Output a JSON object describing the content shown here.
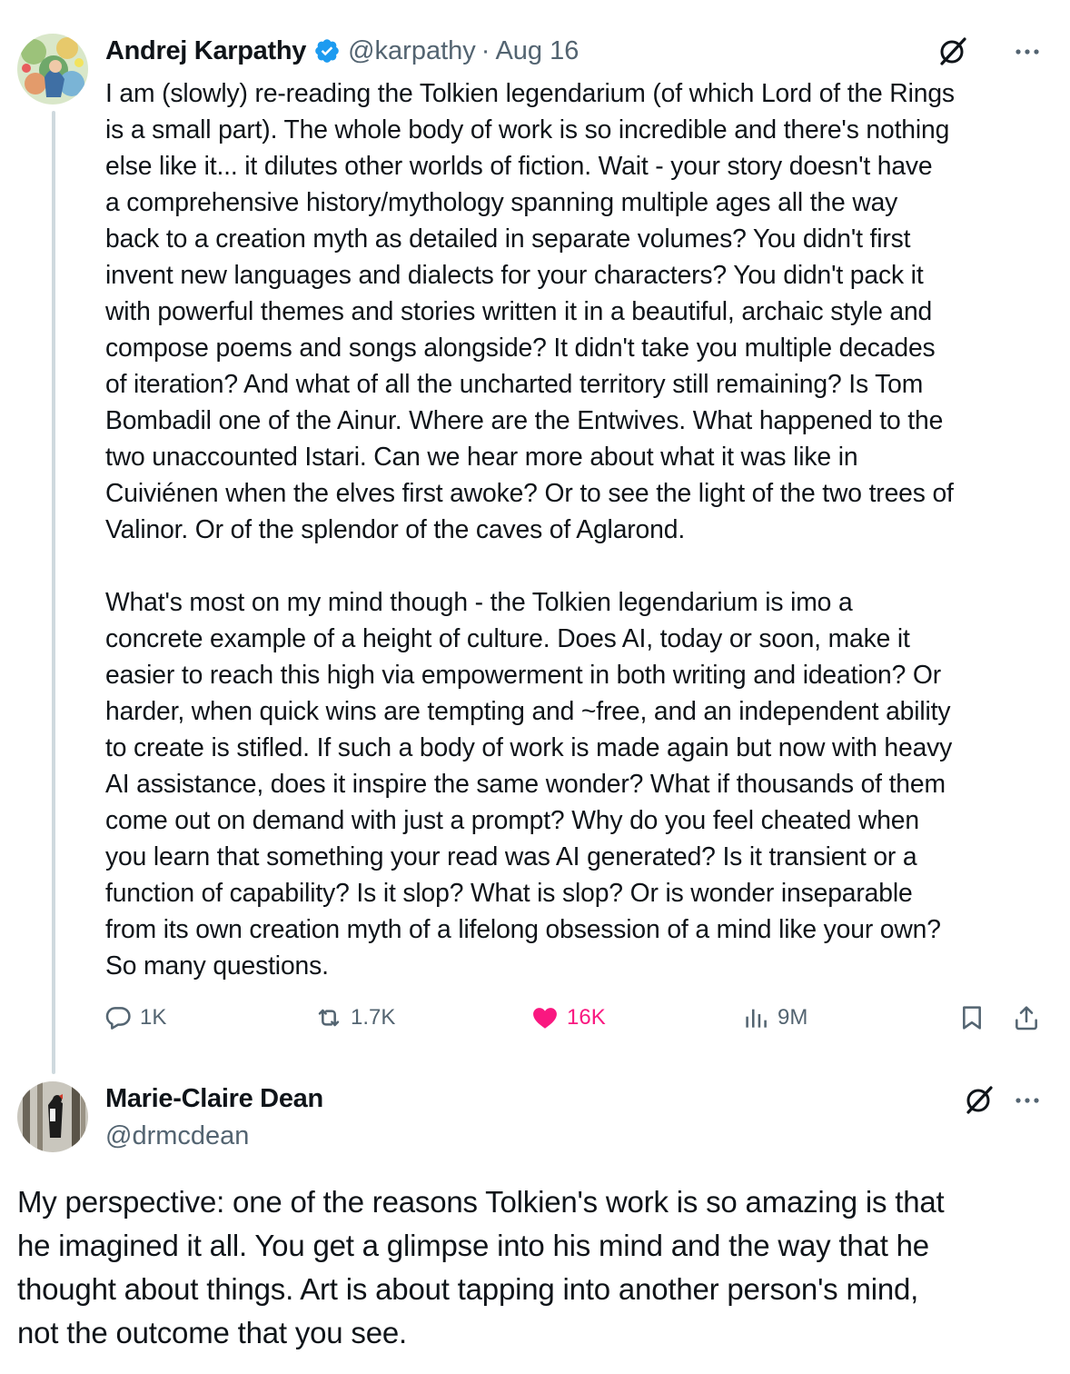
{
  "tweet": {
    "display_name": "Andrej Karpathy",
    "handle": "@karpathy",
    "separator": "·",
    "date": "Aug 16",
    "verified_icon": "verified-badge-icon",
    "lines": [
      "I am (slowly) re-reading the Tolkien legendarium (of which Lord of the Rings",
      "is a small part). The whole body of work is so incredible and there's nothing",
      "else like it... it dilutes other worlds of fiction. Wait - your story doesn't have",
      "a comprehensive history/mythology spanning multiple ages all the way",
      "back to a creation myth as detailed in separate volumes? You didn't first",
      "invent new languages and dialects for your characters? You didn't pack it",
      "with powerful themes and stories written it in a beautiful, archaic style and",
      "compose poems and songs alongside? It didn't take you multiple decades",
      "of iteration? And what of all the uncharted territory still remaining? Is Tom",
      "Bombadil one of the Ainur. Where are the Entwives. What happened to the",
      "two unaccounted Istari. Can we hear more about what it was like in",
      "Cuiviénen when the elves first awoke? Or to see the light of the two trees of",
      "Valinor. Or of the splendor of the caves of Aglarond.",
      "",
      "What's most on my mind though - the Tolkien legendarium is imo a",
      "concrete example of a height of culture. Does AI, today or soon, make it",
      "easier to reach this high via empowerment in both writing and ideation? Or",
      "harder, when quick wins are tempting and ~free, and an independent ability",
      "to create is stifled. If such a body of work is made again but now with heavy",
      "AI assistance, does it inspire the same wonder? What if thousands of them",
      "come out on demand with just a prompt? Why do you feel cheated when",
      "you learn that something your read was AI generated? Is it transient or a",
      "function of capability? Is it slop? What is slop? Or is wonder inseparable",
      "from its own creation myth of a lifelong obsession of a mind like your own?",
      "So many questions."
    ],
    "actions": {
      "replies": "1K",
      "retweets": "1.7K",
      "likes": "16K",
      "views": "9M"
    },
    "like_color": "#f91880"
  },
  "reply": {
    "display_name": "Marie-Claire Dean",
    "handle": "@drmcdean",
    "lines": [
      "My perspective: one of the reasons Tolkien's work is so amazing is that",
      "he imagined it all. You get a glimpse into his mind and the way that he",
      "thought about things. Art is about tapping into another person's mind,",
      "not the outcome that you see."
    ]
  },
  "colors": {
    "text": "#0f1419",
    "secondary": "#536471",
    "verified": "#1d9bf0",
    "thread_line": "#cfd9de"
  }
}
